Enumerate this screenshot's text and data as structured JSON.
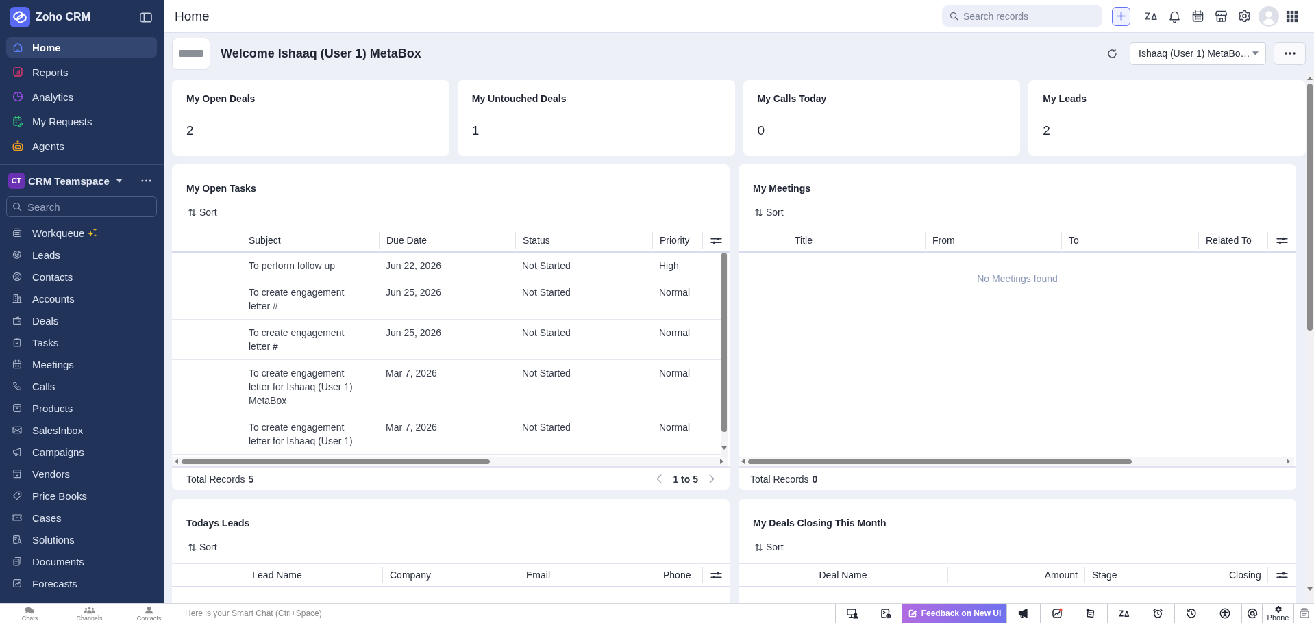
{
  "sidebar": {
    "brand": "Zoho CRM",
    "main_items": [
      {
        "label": "Home",
        "selected": true
      },
      {
        "label": "Reports",
        "selected": false
      },
      {
        "label": "Analytics",
        "selected": false
      },
      {
        "label": "My Requests",
        "selected": false
      },
      {
        "label": "Agents",
        "selected": false
      }
    ],
    "teamspace": {
      "badge": "CT",
      "name": "CRM Teamspace"
    },
    "search": {
      "placeholder": "Search"
    },
    "modules": [
      {
        "label": "Workqueue",
        "selected": false
      },
      {
        "label": "Leads",
        "selected": false
      },
      {
        "label": "Contacts",
        "selected": false
      },
      {
        "label": "Accounts",
        "selected": false
      },
      {
        "label": "Deals",
        "selected": false
      },
      {
        "label": "Tasks",
        "selected": false
      },
      {
        "label": "Meetings",
        "selected": false
      },
      {
        "label": "Calls",
        "selected": false
      },
      {
        "label": "Products",
        "selected": false
      },
      {
        "label": "SalesInbox",
        "selected": false
      },
      {
        "label": "Campaigns",
        "selected": false
      },
      {
        "label": "Vendors",
        "selected": false
      },
      {
        "label": "Price Books",
        "selected": false
      },
      {
        "label": "Cases",
        "selected": false
      },
      {
        "label": "Solutions",
        "selected": false
      },
      {
        "label": "Documents",
        "selected": false
      },
      {
        "label": "Forecasts",
        "selected": false
      }
    ]
  },
  "header": {
    "title": "Home",
    "search": {
      "placeholder": "Search records"
    }
  },
  "welcome": {
    "title": "Welcome Ishaaq (User 1) MetaBox",
    "user_select": {
      "value": "Ishaaq (User 1) MetaBo…"
    }
  },
  "stat_cards": [
    {
      "title": "My Open Deals",
      "value": "2"
    },
    {
      "title": "My Untouched Deals",
      "value": "1"
    },
    {
      "title": "My Calls Today",
      "value": "0"
    },
    {
      "title": "My Leads",
      "value": "2"
    }
  ],
  "panels": [
    {
      "title": "My Open Tasks",
      "sort": "Sort",
      "columns": [
        "Subject",
        "Due Date",
        "Status",
        "Priority"
      ],
      "rows": [
        [
          "To perform follow up",
          "Jun 22, 2026",
          "Not Started",
          "High"
        ],
        [
          "To create engagement letter #",
          "Jun 25, 2026",
          "Not Started",
          "Normal"
        ],
        [
          "To create engagement letter #",
          "Jun 25, 2026",
          "Not Started",
          "Normal"
        ],
        [
          "To create engagement letter for Ishaaq (User 1) MetaBox",
          "Mar 7, 2026",
          "Not Started",
          "Normal"
        ],
        [
          "To create engagement letter for Ishaaq (User 1)",
          "Mar 7, 2026",
          "Not Started",
          "Normal"
        ]
      ],
      "footer": {
        "label": "Total Records",
        "count": "5",
        "page_range": "1 to 5"
      }
    },
    {
      "title": "My Meetings",
      "sort": "Sort",
      "columns": [
        "Title",
        "From",
        "To",
        "Related To"
      ],
      "empty_message": "No Meetings found",
      "footer": {
        "label": "Total Records",
        "count": "0"
      }
    },
    {
      "title": "Todays Leads",
      "sort": "Sort",
      "columns": [
        "Lead Name",
        "Company",
        "Email",
        "Phone"
      ]
    },
    {
      "title": "My Deals Closing This Month",
      "sort": "Sort",
      "columns": [
        "Deal Name",
        "Amount",
        "Stage",
        "Closing"
      ]
    }
  ],
  "bottom_bar": {
    "tabs": [
      "Chats",
      "Channels",
      "Contacts"
    ],
    "chat_placeholder": "Here is your Smart Chat (Ctrl+Space)",
    "feedback": "Feedback on New UI",
    "phone": "Phone"
  }
}
